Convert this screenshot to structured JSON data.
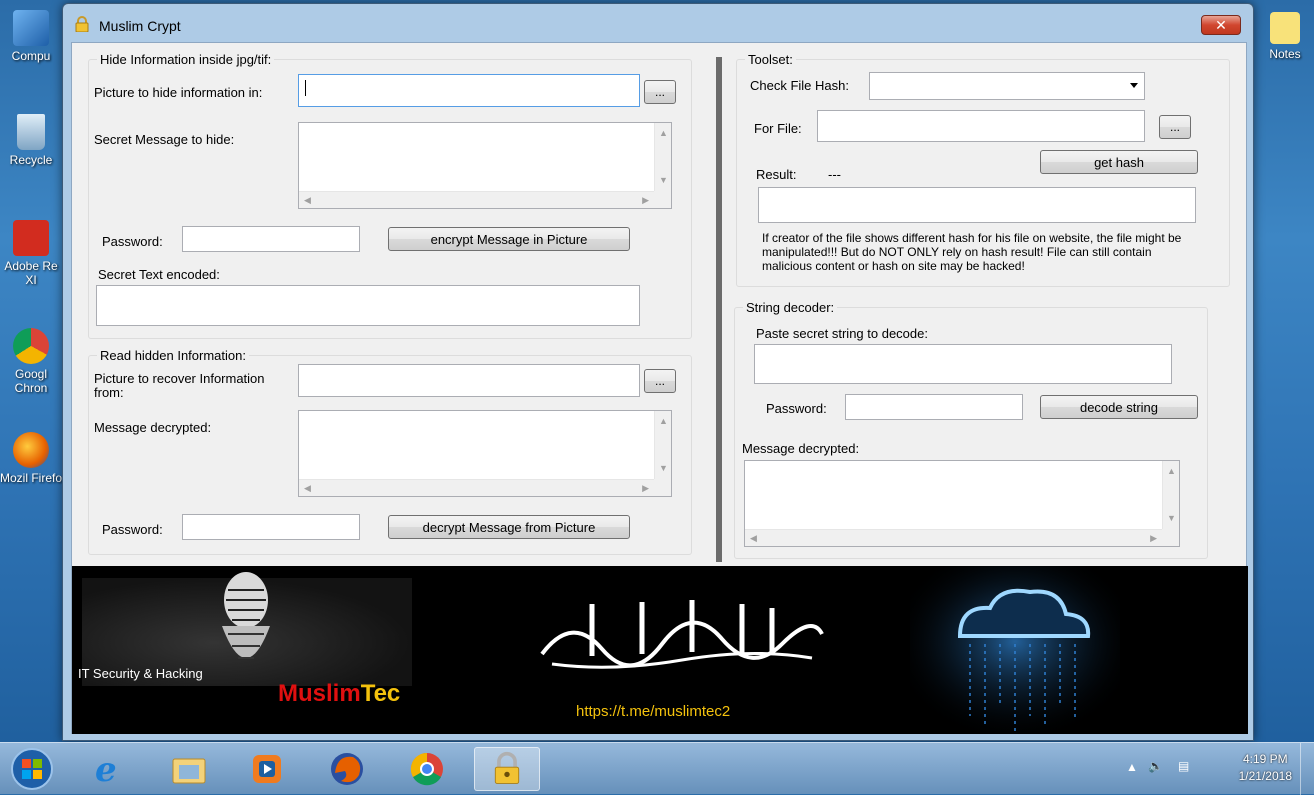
{
  "desktop": {
    "icons": [
      {
        "label": "Compu"
      },
      {
        "label": "Recycle"
      },
      {
        "label": "Adobe Re XI"
      },
      {
        "label": "Googl Chron"
      },
      {
        "label": "Mozil Firefo"
      }
    ],
    "notes_label": "Notes"
  },
  "window": {
    "title": "Muslim Crypt",
    "close_label": "✕"
  },
  "hide": {
    "title": "Hide Information inside jpg/tif:",
    "picture_label": "Picture to hide information in:",
    "browse_label": "...",
    "secret_label": "Secret Message to hide:",
    "password_label": "Password:",
    "encrypt_button": "encrypt Message in Picture",
    "encoded_label": "Secret Text encoded:"
  },
  "read": {
    "title": "Read hidden Information:",
    "picture_label": "Picture to recover Information from:",
    "browse_label": "...",
    "message_label": "Message decrypted:",
    "password_label": "Password:",
    "decrypt_button": "decrypt Message from Picture"
  },
  "toolset": {
    "title": "Toolset:",
    "hash_label": "Check File Hash:",
    "hash_selected": "",
    "file_label": "For File:",
    "browse_label": "...",
    "get_hash_button": "get hash",
    "result_label": "Result:",
    "result_value": "---",
    "warning": "If creator of the file shows different hash for his file on website, the file might be manipulated!!! But do NOT ONLY rely on hash result! File can still contain malicious content or hash on site may be hacked!"
  },
  "decoder": {
    "title": "String decoder:",
    "paste_label": "Paste secret string to decode:",
    "password_label": "Password:",
    "decode_button": "decode string",
    "message_label": "Message decrypted:"
  },
  "banner": {
    "it_text": "IT Security & Hacking",
    "brand_part1": "Muslim",
    "brand_part2": "Tec",
    "url": "https://t.me/muslimtec2"
  },
  "clock": {
    "time": "4:19 PM",
    "date": "1/21/2018"
  },
  "taskbar": {
    "items": [
      "start-orb-icon",
      "internet-explorer-icon",
      "file-explorer-icon",
      "media-player-icon",
      "firefox-icon",
      "chrome-icon",
      "muslim-crypt-lock-icon"
    ]
  },
  "colors": {
    "brand_red": "#e01010",
    "brand_yellow": "#f4c20d",
    "url_yellow": "#f4c20d"
  }
}
